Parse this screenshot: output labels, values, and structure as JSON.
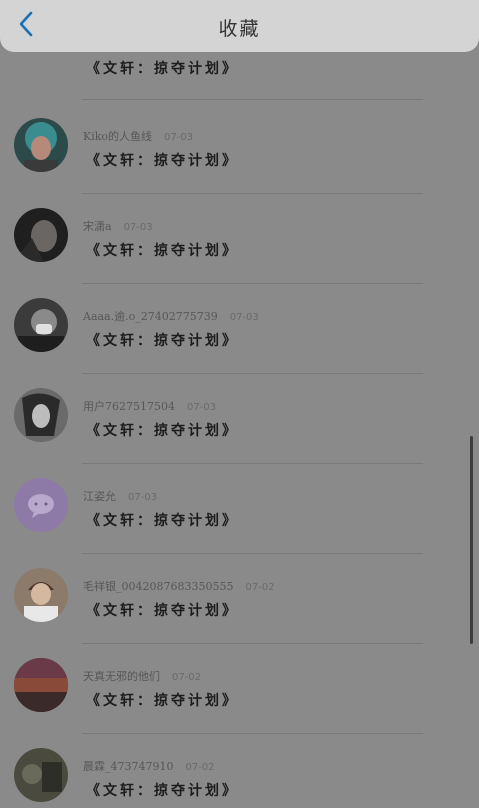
{
  "header": {
    "title": "收藏"
  },
  "items": [
    {
      "name": "",
      "date": "",
      "title": "《文轩：掠夺计划》",
      "avatar_color": "#c9c3bb"
    },
    {
      "name": "Kiko的人鱼线",
      "date": "07-03",
      "title": "《文轩：掠夺计划》",
      "avatar_color": "#3a8c8e"
    },
    {
      "name": "宋潇a",
      "date": "07-03",
      "title": "《文轩：掠夺计划》",
      "avatar_color": "#2a2a2a"
    },
    {
      "name": "Aaaa.逾.o_27402775739",
      "date": "07-03",
      "title": "《文轩：掠夺计划》",
      "avatar_color": "#3b3b3b"
    },
    {
      "name": "用户7627517504",
      "date": "07-03",
      "title": "《文轩：掠夺计划》",
      "avatar_color": "#555555"
    },
    {
      "name": "江姿允",
      "date": "07-03",
      "title": "《文轩：掠夺计划》",
      "avatar_color": "#8d7aa6"
    },
    {
      "name": "毛祥银_0042087683350555",
      "date": "07-02",
      "title": "《文轩：掠夺计划》",
      "avatar_color": "#7a6a5a"
    },
    {
      "name": "天真无邪的他们",
      "date": "07-02",
      "title": "《文轩：掠夺计划》",
      "avatar_color": "#5a2f2a"
    },
    {
      "name": "晨霖_473747910",
      "date": "07-02",
      "title": "《文轩：掠夺计划》",
      "avatar_color": "#4a4a3e"
    }
  ]
}
